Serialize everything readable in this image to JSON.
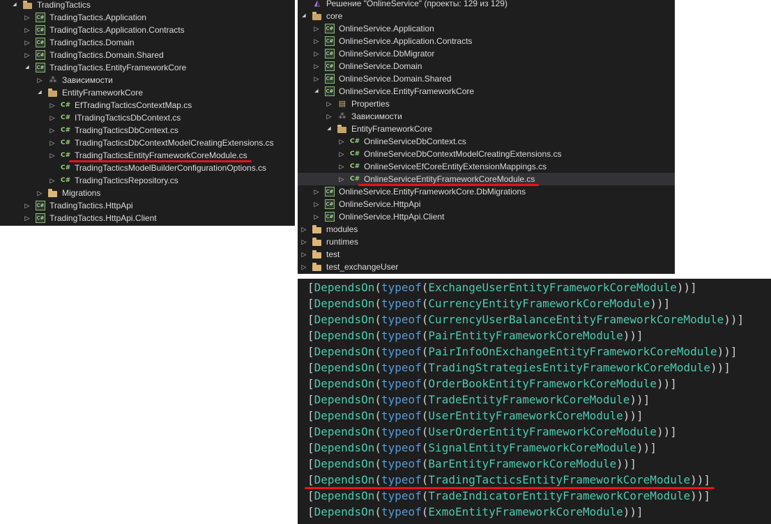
{
  "left_tree": [
    {
      "level": 0,
      "arrow": "open",
      "icon": "folder-open",
      "label": "TradingTactics"
    },
    {
      "level": 1,
      "arrow": "closed",
      "icon": "csharp-project",
      "label": "TradingTactics.Application"
    },
    {
      "level": 1,
      "arrow": "closed",
      "icon": "csharp-project",
      "label": "TradingTactics.Application.Contracts"
    },
    {
      "level": 1,
      "arrow": "closed",
      "icon": "csharp-project",
      "label": "TradingTactics.Domain"
    },
    {
      "level": 1,
      "arrow": "closed",
      "icon": "csharp-project",
      "label": "TradingTactics.Domain.Shared"
    },
    {
      "level": 1,
      "arrow": "open",
      "icon": "csharp-project",
      "label": "TradingTactics.EntityFrameworkCore"
    },
    {
      "level": 2,
      "arrow": "closed",
      "icon": "dependencies",
      "label": "Зависимости"
    },
    {
      "level": 2,
      "arrow": "open",
      "icon": "folder-open",
      "label": "EntityFrameworkCore"
    },
    {
      "level": 3,
      "arrow": "closed",
      "icon": "csharp-file",
      "label": "EfTradingTacticsContextMap.cs"
    },
    {
      "level": 3,
      "arrow": "closed",
      "icon": "csharp-file",
      "label": "ITradingTacticsDbContext.cs"
    },
    {
      "level": 3,
      "arrow": "closed",
      "icon": "csharp-file",
      "label": "TradingTacticsDbContext.cs"
    },
    {
      "level": 3,
      "arrow": "closed",
      "icon": "csharp-file",
      "label": "TradingTacticsDbContextModelCreatingExtensions.cs"
    },
    {
      "level": 3,
      "arrow": "closed",
      "icon": "csharp-file",
      "label": "TradingTacticsEntityFrameworkCoreModule.cs",
      "underlined": true
    },
    {
      "level": 3,
      "arrow": "none",
      "icon": "csharp-file",
      "label": "TradingTacticsModelBuilderConfigurationOptions.cs"
    },
    {
      "level": 3,
      "arrow": "closed",
      "icon": "csharp-file",
      "label": "TradingTacticsRepository.cs"
    },
    {
      "level": 2,
      "arrow": "closed",
      "icon": "folder",
      "label": "Migrations"
    },
    {
      "level": 1,
      "arrow": "closed",
      "icon": "csharp-project",
      "label": "TradingTactics.HttpApi"
    },
    {
      "level": 1,
      "arrow": "closed",
      "icon": "csharp-project",
      "label": "TradingTactics.HttpApi.Client"
    }
  ],
  "right_tree": [
    {
      "level": 0,
      "arrow": "none",
      "icon": "solution",
      "label": "Решение \"OnlineService\" (проекты: 129 из 129)"
    },
    {
      "level": 0,
      "arrow": "open",
      "icon": "folder-open",
      "label": "core"
    },
    {
      "level": 1,
      "arrow": "closed",
      "icon": "csharp-project",
      "label": "OnlineService.Application"
    },
    {
      "level": 1,
      "arrow": "closed",
      "icon": "csharp-project",
      "label": "OnlineService.Application.Contracts"
    },
    {
      "level": 1,
      "arrow": "closed",
      "icon": "csharp-project",
      "label": "OnlineService.DbMigrator"
    },
    {
      "level": 1,
      "arrow": "closed",
      "icon": "csharp-project",
      "label": "OnlineService.Domain"
    },
    {
      "level": 1,
      "arrow": "closed",
      "icon": "csharp-project",
      "label": "OnlineService.Domain.Shared"
    },
    {
      "level": 1,
      "arrow": "open",
      "icon": "csharp-project",
      "label": "OnlineService.EntityFrameworkCore"
    },
    {
      "level": 2,
      "arrow": "closed",
      "icon": "wrench",
      "label": "Properties"
    },
    {
      "level": 2,
      "arrow": "closed",
      "icon": "dependencies",
      "label": "Зависимости"
    },
    {
      "level": 2,
      "arrow": "open",
      "icon": "folder-open",
      "label": "EntityFrameworkCore"
    },
    {
      "level": 3,
      "arrow": "closed",
      "icon": "csharp-file",
      "label": "OnlineServiceDbContext.cs"
    },
    {
      "level": 3,
      "arrow": "closed",
      "icon": "csharp-file",
      "label": "OnlineServiceDbContextModelCreatingExtensions.cs"
    },
    {
      "level": 3,
      "arrow": "closed",
      "icon": "csharp-file",
      "label": "OnlineServiceEfCoreEntityExtensionMappings.cs"
    },
    {
      "level": 3,
      "arrow": "closed",
      "icon": "csharp-file",
      "label": "OnlineServiceEntityFrameworkCoreModule.cs",
      "selected": true,
      "underlined": true
    },
    {
      "level": 1,
      "arrow": "closed",
      "icon": "csharp-project",
      "label": "OnlineService.EntityFrameworkCore.DbMigrations"
    },
    {
      "level": 1,
      "arrow": "closed",
      "icon": "csharp-project",
      "label": "OnlineService.HttpApi"
    },
    {
      "level": 1,
      "arrow": "closed",
      "icon": "csharp-project",
      "label": "OnlineService.HttpApi.Client"
    },
    {
      "level": 0,
      "arrow": "closed",
      "icon": "folder",
      "label": "modules"
    },
    {
      "level": 0,
      "arrow": "closed",
      "icon": "folder",
      "label": "runtimes"
    },
    {
      "level": 0,
      "arrow": "closed",
      "icon": "folder",
      "label": "test"
    },
    {
      "level": 0,
      "arrow": "closed",
      "icon": "folder",
      "label": "test_exchangeUser"
    }
  ],
  "code": {
    "attribute": "DependsOn",
    "keyword": "typeof",
    "lines": [
      {
        "type": "ExchangeUserEntityFrameworkCoreModule"
      },
      {
        "type": "CurrencyEntityFrameworkCoreModule"
      },
      {
        "type": "CurrencyUserBalanceEntityFrameworkCoreModule"
      },
      {
        "type": "PairEntityFrameworkCoreModule"
      },
      {
        "type": "PairInfoOnExchangeEntityFrameworkCoreModule"
      },
      {
        "type": "TradingStrategiesEntityFrameworkCoreModule"
      },
      {
        "type": "OrderBookEntityFrameworkCoreModule"
      },
      {
        "type": "TradeEntityFrameworkCoreModule"
      },
      {
        "type": "UserEntityFrameworkCoreModule"
      },
      {
        "type": "UserOrderEntityFrameworkCoreModule"
      },
      {
        "type": "SignalEntityFrameworkCoreModule"
      },
      {
        "type": "BarEntityFrameworkCoreModule"
      },
      {
        "type": "TradingTacticsEntityFrameworkCoreModule",
        "underlined": true
      },
      {
        "type": "TradeIndicatorEntityFrameworkCoreModule"
      },
      {
        "type": "ExmoEntityFrameworkCoreModule"
      }
    ]
  },
  "colors": {
    "accent_underline": "#e8131c",
    "selection": "#333337",
    "background": "#1e1e1e"
  }
}
